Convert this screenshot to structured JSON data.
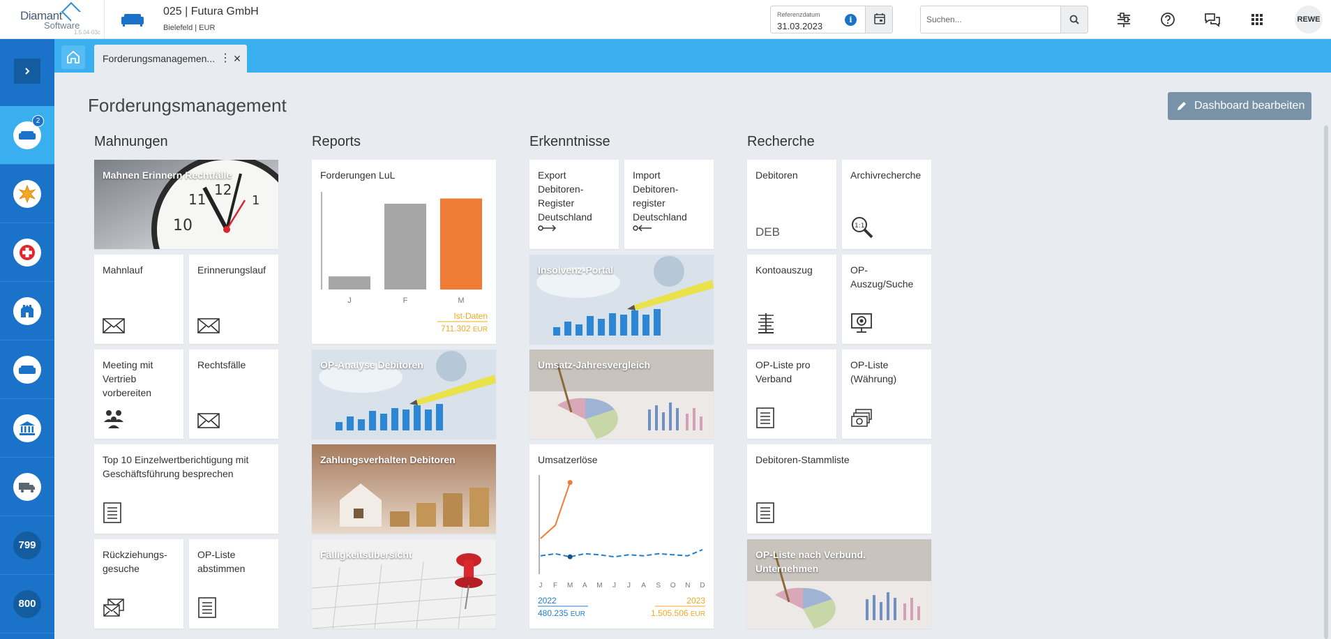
{
  "app": {
    "logo_line1": "Diamant",
    "logo_line2": "Software",
    "version": "1.5.04-03c",
    "company_name": "025 | Futura GmbH",
    "company_sub": "Bielefeld | EUR"
  },
  "header": {
    "ref_label": "Referenzdatum",
    "ref_value": "31.03.2023",
    "search_placeholder": "Suchen...",
    "avatar": "REWE"
  },
  "nav": {
    "badge": "2",
    "num1": "799",
    "num2": "800"
  },
  "tab": {
    "label": "Forderungsmanagemen..."
  },
  "page": {
    "title": "Forderungsmanagement",
    "edit_button": "Dashboard bearbeiten"
  },
  "columns": {
    "mahnungen": "Mahnungen",
    "reports": "Reports",
    "erkenntnisse": "Erkenntnisse",
    "recherche": "Recherche"
  },
  "tiles": {
    "mahnen": "Mahnen Erinnern Rechtfälle",
    "mahnlauf": "Mahnlauf",
    "erinnerungslauf": "Erinnerungslauf",
    "meeting": "Meeting mit Vertrieb vorbereiten",
    "rechtsfaelle": "Rechtsfälle",
    "top10": "Top 10 Einzelwertberichtigung mit Geschäftsführung besprechen",
    "rueckziehung": "Rückziehungs-gesuche",
    "opliste_abstimmen": "OP-Liste abstimmen",
    "forderungen": "Forderungen LuL",
    "op_analyse": "OP-Analyse Debitoren",
    "zahlungsverhalten": "Zahlungsverhalten Debitoren",
    "faelligkeit": "Fälligkeitsübersicht",
    "export": "Export Debitoren-Register Deutschland",
    "import": "Import Debitoren-register Deutschland",
    "insolvenz": "Insolvenz-Portal",
    "umsatz_vergleich": "Umsatz-Jahresvergleich",
    "umsatzerloese": "Umsatzerlöse",
    "debitoren": "Debitoren",
    "deb": "DEB",
    "archiv": "Archivrecherche",
    "kontoauszug": "Kontoauszug",
    "op_auszug": "OP-Auszug/Suche",
    "op_verband": "OP-Liste pro Verband",
    "op_waehrung": "OP-Liste (Währung)",
    "stammliste": "Debitoren-Stammliste",
    "op_verbund": "OP-Liste nach Verbund. Unternehmen"
  },
  "chart_data": [
    {
      "type": "bar",
      "title": "Forderungen LuL",
      "categories": [
        "J",
        "F",
        "M"
      ],
      "values": [
        15,
        98,
        104
      ],
      "ylim": [
        0,
        110
      ],
      "colors": [
        "#a6a6a6",
        "#a6a6a6",
        "#ef7b35"
      ],
      "legend_label": "Ist-Daten",
      "total": "711.302",
      "unit": "EUR"
    },
    {
      "type": "line",
      "title": "Umsatzerlöse",
      "categories": [
        "J",
        "F",
        "M",
        "A",
        "M",
        "J",
        "J",
        "A",
        "S",
        "O",
        "N",
        "D"
      ],
      "ylim": [
        0,
        100
      ],
      "series": [
        {
          "name": "2023",
          "color": "#ef7b35",
          "values": [
            35,
            48,
            90
          ],
          "total": "1.505.506"
        },
        {
          "name": "2022",
          "color": "#1d7fd0",
          "values": [
            18,
            20,
            17,
            20,
            19,
            17,
            19,
            18,
            20,
            19,
            18,
            24
          ],
          "total": "480.235"
        }
      ],
      "unit": "EUR"
    }
  ]
}
